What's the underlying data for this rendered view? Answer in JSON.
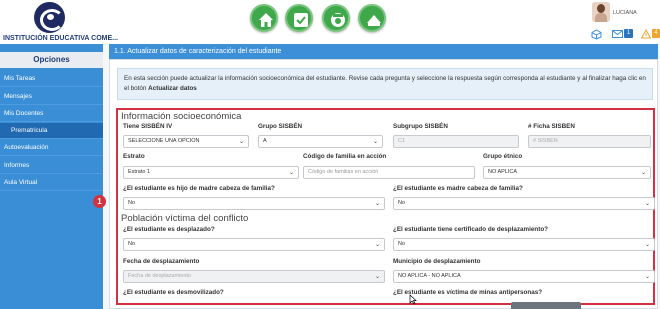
{
  "header": {
    "institution": "INSTITUCIÓN EDUCATIVA COME...",
    "user_name": "LUCIANA",
    "mail_count": "1",
    "alert_count": "4",
    "nav_icons": [
      "home-icon",
      "check-icon",
      "disc-icon",
      "dome-icon"
    ]
  },
  "sidebar": {
    "title": "Opciones",
    "items": [
      {
        "label": "Mis Tareas"
      },
      {
        "label": "Mensajes"
      },
      {
        "label": "Mis Docentes"
      },
      {
        "label": "Prematricula"
      },
      {
        "label": "Autoevaluación"
      },
      {
        "label": "Informes"
      },
      {
        "label": "Aula Virtual"
      }
    ]
  },
  "panel": {
    "title": "1.1. Actualizar datos de caracterización del estudiante",
    "info_text": "En esta sección puede actualizar la información socioeconómica del estudiante. Revise cada pregunta y seleccione la respuesta según corresponda al estudiante y al finalizar haga clic en el botón",
    "info_bold": "Actualizar datos"
  },
  "marker": "1",
  "socio": {
    "title": "Información socioeconómica",
    "tipo_sisben_label": "Tiene SISBÉN IV",
    "tipo_sisben_value": "SELECCIONE UNA OPCION",
    "grupo_sisben_label": "Grupo SISBÉN",
    "grupo_sisben_value": "A",
    "subgrupo_label": "Subgrupo SISBÉN",
    "subgrupo_placeholder": "C1",
    "ficha_label": "# Ficha SISBEN",
    "ficha_placeholder": "# SISBEN",
    "estrato_label": "Estrato",
    "estrato_value": "Estrato 1",
    "codigo_label": "Código de familia en acción",
    "codigo_placeholder": "Código de familias en acción",
    "etnico_label": "Grupo étnico",
    "etnico_value": "NO APLICA",
    "hijo_madre_label": "¿El estudiante es hijo de madre cabeza de familia?",
    "hijo_madre_value": "No",
    "es_madre_label": "¿El estudiante es madre cabeza de familia?",
    "es_madre_value": "No"
  },
  "victima": {
    "title": "Población víctima del conflicto",
    "desplazado_label": "¿El estudiante es desplazado?",
    "desplazado_value": "No",
    "certificado_label": "¿El estudiante tiene certificado de desplazamiento?",
    "certificado_value": "No",
    "fecha_label": "Fecha de desplazamiento",
    "fecha_value": "Fecha de desplazamiento",
    "municipio_label": "Municipio de desplazamiento",
    "municipio_value": "NO APLICA - NO APLICA",
    "desmovilizado_label": "¿El estudiante es desmovilizado?",
    "minas_label": "¿El estudiante es víctima de minas antipersonas?"
  },
  "colors": {
    "primary": "#3d8fd8",
    "sidebar": "#3a8ed6",
    "highlight": "#d43040",
    "nav_green": "#3ea84a"
  }
}
